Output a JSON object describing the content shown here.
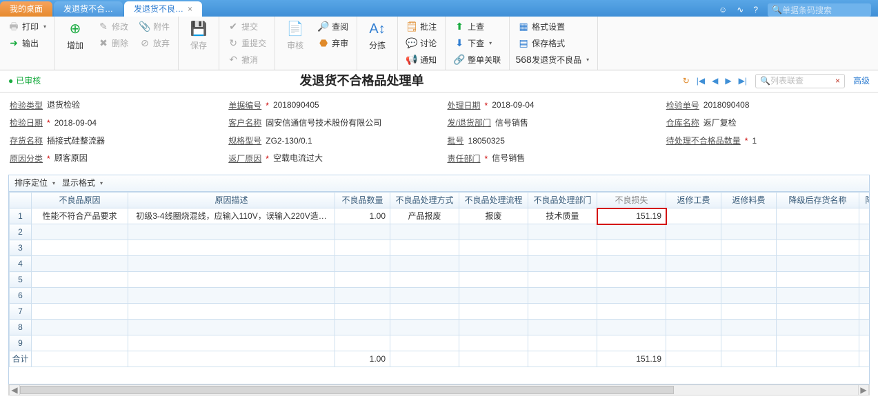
{
  "tabs": {
    "desktop": "我的桌面",
    "t1": "发退货不合…",
    "t2": "发退货不良…"
  },
  "topsearch_placeholder": "单据条码搜索",
  "ribbon": {
    "print": "打印",
    "output": "输出",
    "addnew": "增加",
    "modify": "修改",
    "attachment": "附件",
    "delete": "删除",
    "abandon": "放弃",
    "save": "保存",
    "submit": "提交",
    "resubmit": "重提交",
    "revoke": "撤消",
    "audit": "审核",
    "query": "查阅",
    "discard": "弃审",
    "sort": "分拣",
    "batchapprove": "批注",
    "discuss": "讨论",
    "notify": "通知",
    "check_up": "上查",
    "check_down": "下查",
    "relation": "整单关联",
    "format_set": "格式设置",
    "save_format": "保存格式",
    "defect_link_num": "568",
    "defect_link": "发退货不良品"
  },
  "status": "已审核",
  "doc_title": "发退货不合格品处理单",
  "listsearch_placeholder": "列表联查",
  "advanced": "高级",
  "form": {
    "f1l": "检验类型",
    "f1v": "退货检验",
    "f2l": "单据编号",
    "f2v": "2018090405",
    "f3l": "处理日期",
    "f3v": "2018-09-04",
    "f4l": "检验单号",
    "f4v": "2018090408",
    "f5l": "检验日期",
    "f5v": "2018-09-04",
    "f6l": "客户名称",
    "f6v": "固安信通信号技术股份有限公司",
    "f7l": "发/退货部门",
    "f7v": "信号销售",
    "f8l": "仓库名称",
    "f8v": "返厂复检",
    "f9l": "存货名称",
    "f9v": "插接式硅整流器",
    "f10l": "规格型号",
    "f10v": "ZG2-130/0.1",
    "f11l": "批号",
    "f11v": "18050325",
    "f12l": "待处理不合格品数量",
    "f12v": "1",
    "f13l": "原因分类",
    "f13v": "顾客原因",
    "f14l": "返厂原因",
    "f14v": "空载电流过大",
    "f15l": "责任部门",
    "f15v": "信号销售"
  },
  "gridtb": {
    "sortpos": "排序定位",
    "dispfmt": "显示格式"
  },
  "cols": {
    "c1": "不良品原因",
    "c2": "原因描述",
    "c3": "不良品数量",
    "c4": "不良品处理方式",
    "c5": "不良品处理流程",
    "c6": "不良品处理部门",
    "c7": "不良损失",
    "c8": "返修工费",
    "c9": "返修料费",
    "c10": "降级后存货名称",
    "c11": "降"
  },
  "row1": {
    "c1": "性能不符合产品要求",
    "c2": "初级3-4线圈烧混线，应输入110V，误输入220V造…",
    "c3": "1.00",
    "c4": "产品报废",
    "c5": "报废",
    "c6": "技术质量",
    "c7": "151.19"
  },
  "total": {
    "label": "合计",
    "c3": "1.00",
    "c7": "151.19"
  }
}
